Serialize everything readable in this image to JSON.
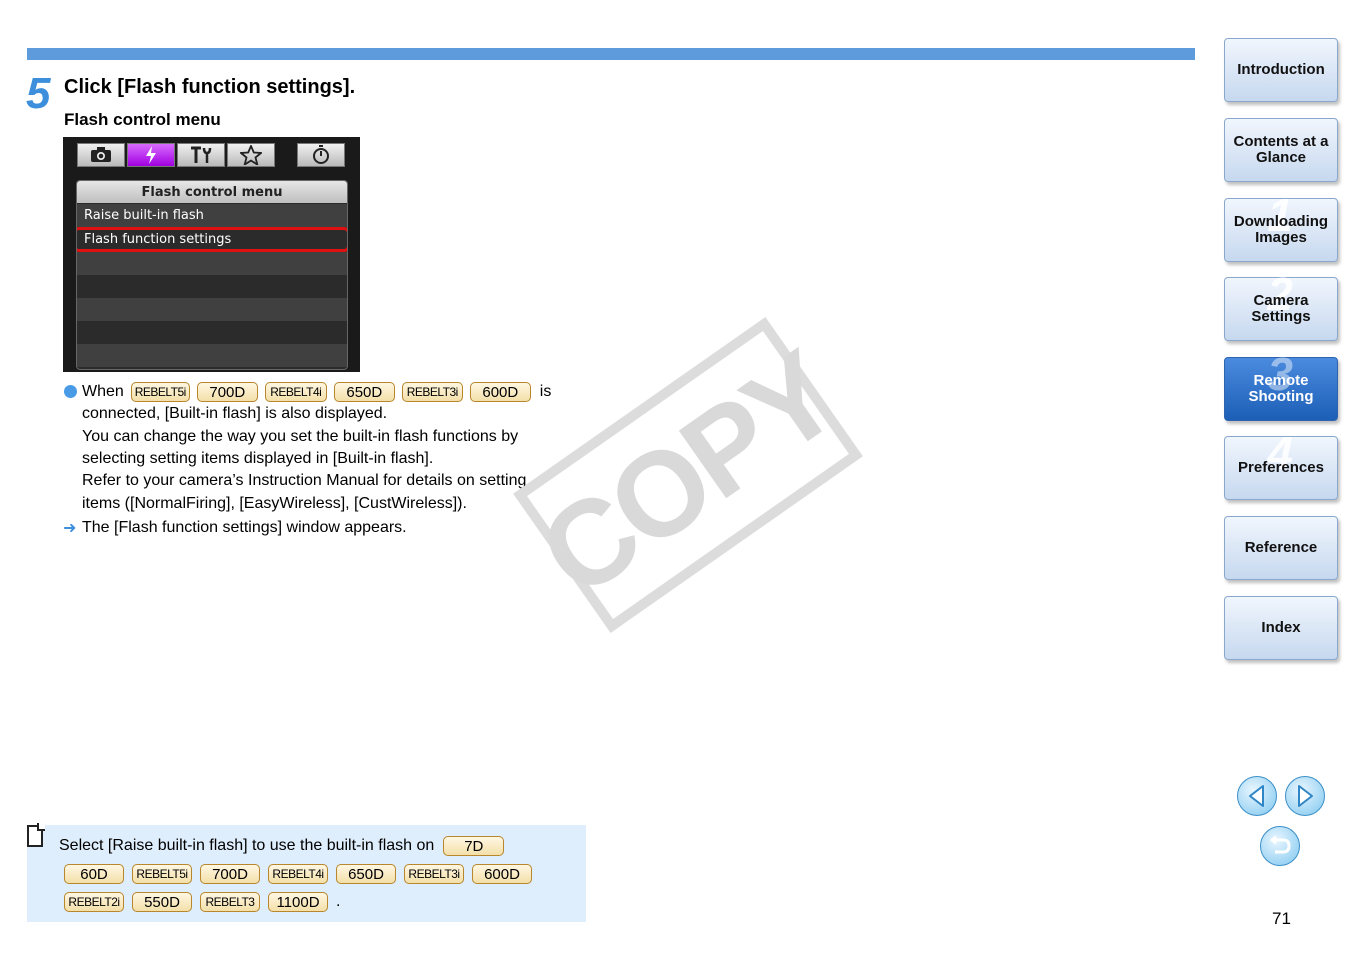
{
  "step": {
    "number": "5",
    "title": "Click [Flash function settings].",
    "subtitle": "Flash control menu"
  },
  "camera_screen": {
    "tab_icons": [
      "camera-icon",
      "flash-icon",
      "tools-icon",
      "star-icon",
      "timer-icon"
    ],
    "selected_tab": "flash-icon",
    "menu_title": "Flash control menu",
    "items": [
      "Raise built-in flash",
      "Flash function settings"
    ],
    "highlighted_item": "Flash function settings"
  },
  "bullet": {
    "when": "When",
    "badges": [
      "REBELT5i",
      "700D",
      "REBELT4i",
      "650D",
      "REBELT3i",
      "600D"
    ],
    "is": "is",
    "lines": [
      "connected, [Built-in flash] is also displayed.",
      "You can change the way you set the built-in flash functions by",
      "selecting setting items displayed in [Built-in flash].",
      "Refer to your camera’s Instruction Manual for details on setting",
      "items ([NormalFiring], [EasyWireless], [CustWireless])."
    ],
    "result": "The [Flash function settings] window appears."
  },
  "watermark": "COPY",
  "note": {
    "text": "Select [Raise built-in flash] to use the built-in flash on",
    "badge_first": "7D",
    "row2": [
      "60D",
      "REBELT5i",
      "700D",
      "REBELT4i",
      "650D",
      "REBELT3i",
      "600D"
    ],
    "row3": [
      "REBELT2i",
      "550D",
      "REBELT3",
      "1100D"
    ],
    "end": "."
  },
  "sidebar": {
    "items": [
      {
        "label": "Introduction",
        "num": ""
      },
      {
        "label": "Contents at a Glance",
        "num": ""
      },
      {
        "label": "Downloading Images",
        "num": "1"
      },
      {
        "label": "Camera Settings",
        "num": "2"
      },
      {
        "label": "Remote Shooting",
        "num": "3"
      },
      {
        "label": "Preferences",
        "num": "4"
      },
      {
        "label": "Reference",
        "num": ""
      },
      {
        "label": "Index",
        "num": ""
      }
    ],
    "active": "Remote Shooting"
  },
  "navigation": {
    "prev_icon": "left-arrow-icon",
    "next_icon": "right-arrow-icon",
    "back_icon": "return-icon"
  },
  "page_number": "71",
  "colors": {
    "accent": "#5d9bdc",
    "active_nav": "#2566bf",
    "badge_fill": "#f3dfa9",
    "note_bg": "#dfeefc",
    "highlight": "#e01010"
  }
}
